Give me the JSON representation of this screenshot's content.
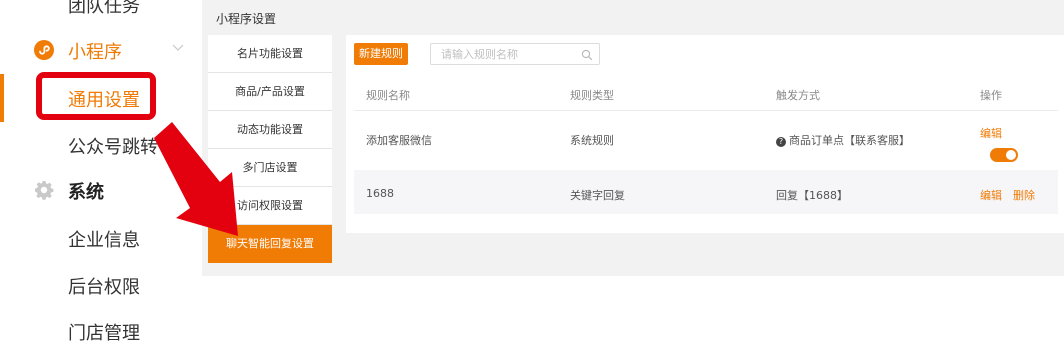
{
  "sidebar": {
    "items": [
      {
        "label": "团队任务"
      },
      {
        "label": "小程序"
      },
      {
        "label": "通用设置"
      },
      {
        "label": "公众号跳转"
      },
      {
        "label": "系统"
      },
      {
        "label": "企业信息"
      },
      {
        "label": "后台权限"
      },
      {
        "label": "门店管理"
      }
    ],
    "icons": {
      "miniprogram": "miniprogram-icon",
      "system": "gear-icon",
      "collapse": "chevron-down-icon"
    }
  },
  "breadcrumb": "小程序设置",
  "settings_menu": [
    {
      "label": "名片功能设置"
    },
    {
      "label": "商品/产品设置"
    },
    {
      "label": "动态功能设置"
    },
    {
      "label": "多门店设置"
    },
    {
      "label": "访问权限设置"
    },
    {
      "label": "聊天智能回复设置"
    }
  ],
  "toolbar": {
    "new_rule_label": "新建规则",
    "search_placeholder": "请输入规则名称"
  },
  "table": {
    "headers": [
      "规则名称",
      "规则类型",
      "触发方式",
      "操作"
    ],
    "rows": [
      {
        "name": "添加客服微信",
        "type": "系统规则",
        "trigger": "商品订单点【联系客服】",
        "edit": "编辑",
        "enabled": true
      },
      {
        "name": "1688",
        "type": "关键字回复",
        "trigger": "回复【1688】",
        "edit": "编辑",
        "delete": "删除"
      }
    ]
  },
  "colors": {
    "accent": "#f07b05",
    "highlight": "#e3000f",
    "panel": "#f2f2f2"
  }
}
